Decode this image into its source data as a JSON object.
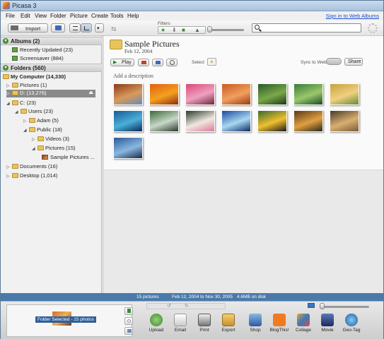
{
  "window": {
    "title": "Picasa 3"
  },
  "menu": {
    "items": [
      "File",
      "Edit",
      "View",
      "Folder",
      "Picture",
      "Create",
      "Tools",
      "Help"
    ],
    "signin": "Sign in to Web Albums"
  },
  "toolbar": {
    "import_label": "Import",
    "filters_label": "Filters"
  },
  "sidebar": {
    "albums_header": "Albums (2)",
    "albums": [
      "Recently Updated (23)",
      "Screensaver (884)"
    ],
    "folders_header": "Folders (560)",
    "tree": [
      {
        "label": "My Computer (14,330)"
      },
      {
        "label": "Pictures (1)"
      },
      {
        "label": "D: (13,276)"
      },
      {
        "label": "C: (23)"
      },
      {
        "label": "Users (23)"
      },
      {
        "label": "Adam (5)"
      },
      {
        "label": "Public (18)"
      },
      {
        "label": "Videos (3)"
      },
      {
        "label": "Pictures (15)"
      },
      {
        "label": "Sample Pictures ..."
      },
      {
        "label": "Documents (16)"
      },
      {
        "label": "Desktop (1,014)"
      }
    ]
  },
  "folder": {
    "title": "Sample Pictures",
    "date": "Feb 12, 2004",
    "play_label": "Play",
    "select_label": "Select",
    "sync_label": "Sync to Web",
    "share_label": "Share",
    "description_placeholder": "Add a description"
  },
  "thumbnails": [
    {
      "name": "desert-landscape",
      "colors": [
        "#8a3a1a",
        "#d89a5a",
        "#6a8ab8"
      ]
    },
    {
      "name": "orange-flowers",
      "colors": [
        "#e06010",
        "#f5a020",
        "#8a3010"
      ]
    },
    {
      "name": "pink-tree",
      "colors": [
        "#d84a7a",
        "#f0a0c0",
        "#6a2a3a"
      ]
    },
    {
      "name": "sand-dunes",
      "colors": [
        "#c85a20",
        "#f0a060",
        "#9a3a10"
      ]
    },
    {
      "name": "forest",
      "colors": [
        "#2a5a2a",
        "#7aa84a",
        "#1a3a1a"
      ]
    },
    {
      "name": "green-plants",
      "colors": [
        "#3a7a3a",
        "#9ac86a",
        "#1a4a2a"
      ]
    },
    {
      "name": "autumn-leaves",
      "colors": [
        "#c8a040",
        "#f0d080",
        "#6a8a3a"
      ]
    },
    {
      "name": "sea-turtle",
      "colors": [
        "#1a5a9a",
        "#4ab0d8",
        "#0a2a5a"
      ]
    },
    {
      "name": "waterfall",
      "colors": [
        "#3a6a3a",
        "#c8d8c8",
        "#2a3a2a"
      ]
    },
    {
      "name": "frangipani",
      "colors": [
        "#2a3a2a",
        "#f0e8e0",
        "#d87a9a"
      ]
    },
    {
      "name": "blue-iceberg",
      "colors": [
        "#1a4aa0",
        "#a8d8f0",
        "#0a2a6a"
      ]
    },
    {
      "name": "toucan",
      "colors": [
        "#3a6a2a",
        "#f0c030",
        "#1a1a1a"
      ]
    },
    {
      "name": "autumn-tree",
      "colors": [
        "#5a3a1a",
        "#e0a040",
        "#2a2a1a"
      ]
    },
    {
      "name": "oak-tree",
      "colors": [
        "#4a3a2a",
        "#d8b070",
        "#7a5a3a"
      ]
    },
    {
      "name": "whale-tail",
      "colors": [
        "#2a5a9a",
        "#8ab8e0",
        "#1a2a4a"
      ]
    }
  ],
  "status": {
    "count": "15 pictures",
    "range": "Feb 12, 2004 to Nov 30, 2005",
    "size": "4.6MB on disk"
  },
  "tray": {
    "label": "Folder Selected - 15 photos",
    "tools": [
      "Upload",
      "Email",
      "Print",
      "Export",
      "Shop",
      "BlogThis!",
      "Collage",
      "Movie",
      "Geo-Tag"
    ]
  }
}
